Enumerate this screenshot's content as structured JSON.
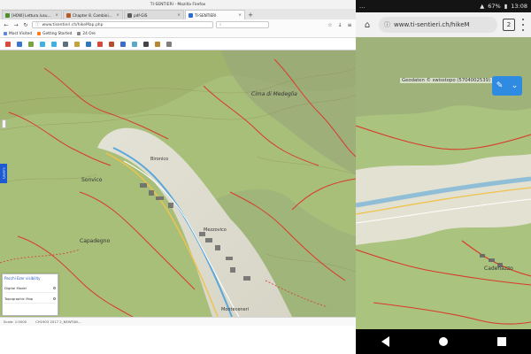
{
  "desktop": {
    "window_title": "TI-SENTIERI - Mozilla Firefox",
    "tabs": [
      {
        "label": "[HOW] Lettura /usuar...",
        "active": false,
        "color": "#4b8f2b"
      },
      {
        "label": "Chapter 8. Combining map...",
        "active": false,
        "color": "#b55b2a"
      },
      {
        "label": "pdf-GIS",
        "active": false,
        "color": "#5a5a5a"
      },
      {
        "label": "TI-SENTIERI",
        "active": true,
        "color": "#2b6cd6"
      }
    ],
    "url": "www.tisentieri.ch/hikeMap.php",
    "bookmarks": [
      {
        "label": "Most Visited",
        "color": "#5d86d7"
      },
      {
        "label": "Getting Started",
        "color": "#ff7a1a"
      },
      {
        "label": "24 Ore",
        "color": "#888888"
      }
    ],
    "map": {
      "labels": {
        "l1": "Sonvico",
        "l2": "Capadegno",
        "l3": "Cima di Medeglia",
        "l4": "Bironico",
        "l5": "Mezzovico",
        "l6": "Monteceneri"
      }
    },
    "sidetab_label": "Layers",
    "layer_panel": {
      "title": "Pacchi Ezer visibility",
      "row1": "Digital Model",
      "row2": "Topographic Map"
    },
    "status": {
      "left": "Scale: 1:5000",
      "coords": "CH1903 2017  2_NEWTAB..."
    }
  },
  "mobile": {
    "status_time": "13:08",
    "battery": "67%",
    "url": "www.ti-sentieri.ch/hikeM",
    "tabs_count": "2",
    "copyright": "Geodaten © swisstopo (5704002539)",
    "map_labels": {
      "m1": "Cadenazzo"
    }
  },
  "colors": {
    "accent": "#2f8be2",
    "sidetab": "#1e5bd1",
    "route_red": "#d83a2b"
  }
}
